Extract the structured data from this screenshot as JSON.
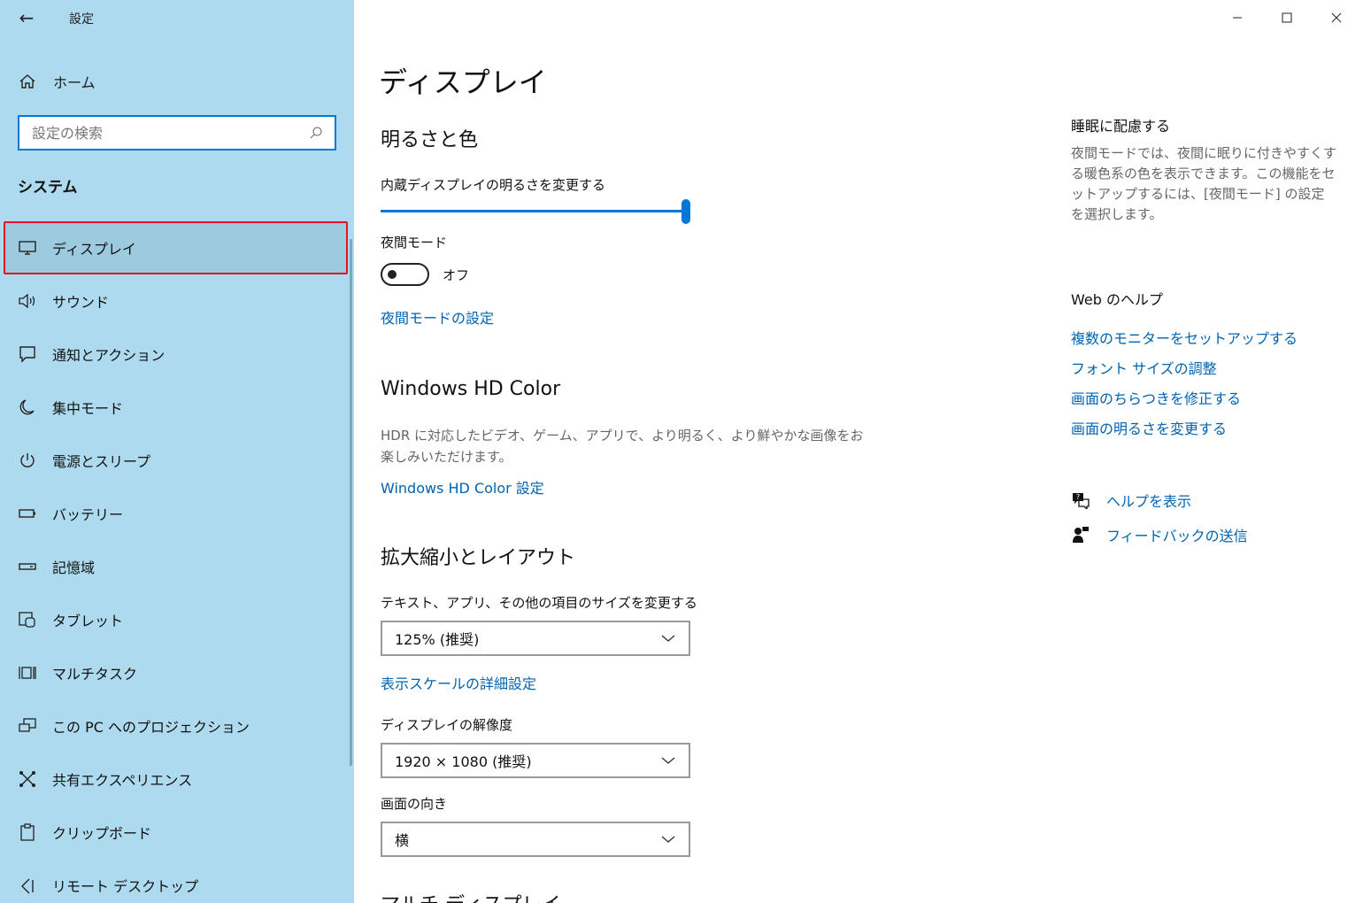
{
  "app": {
    "title": "設定",
    "back_icon": "back-arrow-icon"
  },
  "window_controls": {
    "minimize": "minimize-icon",
    "maximize": "maximize-icon",
    "close": "close-icon"
  },
  "sidebar": {
    "home_label": "ホーム",
    "search_placeholder": "設定の検索",
    "section_label": "システム",
    "items": [
      {
        "label": "ディスプレイ",
        "icon": "monitor-icon",
        "selected": true
      },
      {
        "label": "サウンド",
        "icon": "speaker-icon"
      },
      {
        "label": "通知とアクション",
        "icon": "notification-icon"
      },
      {
        "label": "集中モード",
        "icon": "moon-icon"
      },
      {
        "label": "電源とスリープ",
        "icon": "power-icon"
      },
      {
        "label": "バッテリー",
        "icon": "battery-icon"
      },
      {
        "label": "記憶域",
        "icon": "storage-icon"
      },
      {
        "label": "タブレット",
        "icon": "tablet-icon"
      },
      {
        "label": "マルチタスク",
        "icon": "multitask-icon"
      },
      {
        "label": "この PC へのプロジェクション",
        "icon": "projection-icon"
      },
      {
        "label": "共有エクスペリエンス",
        "icon": "shared-icon"
      },
      {
        "label": "クリップボード",
        "icon": "clipboard-icon"
      },
      {
        "label": "リモート デスクトップ",
        "icon": "remote-desktop-icon"
      }
    ]
  },
  "main": {
    "title": "ディスプレイ",
    "brightness_section": "明るさと色",
    "brightness_label": "内蔵ディスプレイの明るさを変更する",
    "brightness_value": 1.0,
    "night_mode_label": "夜間モード",
    "night_mode_state": "オフ",
    "night_mode_settings_link": "夜間モードの設定",
    "hdr_section": "Windows HD Color",
    "hdr_desc": "HDR に対応したビデオ、ゲーム、アプリで、より明るく、より鮮やかな画像をお楽しみいただけます。",
    "hdr_link": "Windows HD Color 設定",
    "scale_section": "拡大縮小とレイアウト",
    "scale_label": "テキスト、アプリ、その他の項目のサイズを変更する",
    "scale_value": "125% (推奨)",
    "scale_advanced_link": "表示スケールの詳細設定",
    "resolution_label": "ディスプレイの解像度",
    "resolution_value": "1920 × 1080 (推奨)",
    "orientation_label": "画面の向き",
    "orientation_value": "横",
    "multi_display_section": "マルチ ディスプレイ"
  },
  "right": {
    "sleep_title": "睡眠に配慮する",
    "sleep_desc": "夜間モードでは、夜間に眠りに付きやすくする暖色系の色を表示できます。この機能をセットアップするには、[夜間モード] の設定を選択します。",
    "web_help_title": "Web のヘルプ",
    "links": [
      "複数のモニターをセットアップする",
      "フォント サイズの調整",
      "画面のちらつきを修正する",
      "画面の明るさを変更する"
    ],
    "help_label": "ヘルプを表示",
    "feedback_label": "フィードバックの送信"
  }
}
